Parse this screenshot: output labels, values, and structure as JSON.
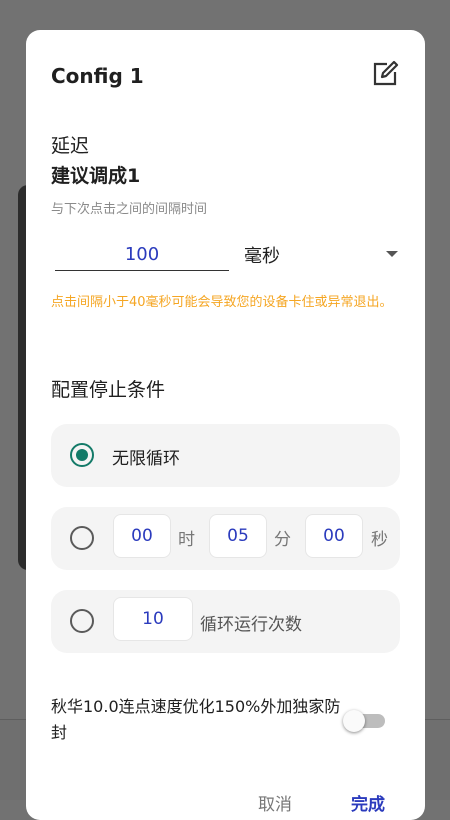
{
  "dialog": {
    "title": "Config 1",
    "edit_icon": "edit-icon"
  },
  "delay": {
    "heading": "延迟",
    "subheading": "建议调成1",
    "hint": "与下次点击之间的间隔时间",
    "value": "100",
    "unit": "毫秒",
    "warning": "点击间隔小于40毫秒可能会导致您的设备卡住或异常退出。"
  },
  "stop": {
    "heading": "配置停止条件",
    "options": [
      {
        "label": "无限循环",
        "checked": true
      },
      {
        "checked": false,
        "hours": "00",
        "hours_unit": "时",
        "minutes": "05",
        "minutes_unit": "分",
        "seconds": "00",
        "seconds_unit": "秒"
      },
      {
        "checked": false,
        "count": "10",
        "label": "循环运行次数"
      }
    ]
  },
  "promo": {
    "label": "秋华10.0连点速度优化150%外加独家防封",
    "enabled": false
  },
  "buttons": {
    "cancel": "取消",
    "done": "完成"
  },
  "colors": {
    "accent": "#137a68",
    "warning": "#f5a623",
    "value_text": "#2b3bbd",
    "primary_button": "#2b3bbd"
  }
}
